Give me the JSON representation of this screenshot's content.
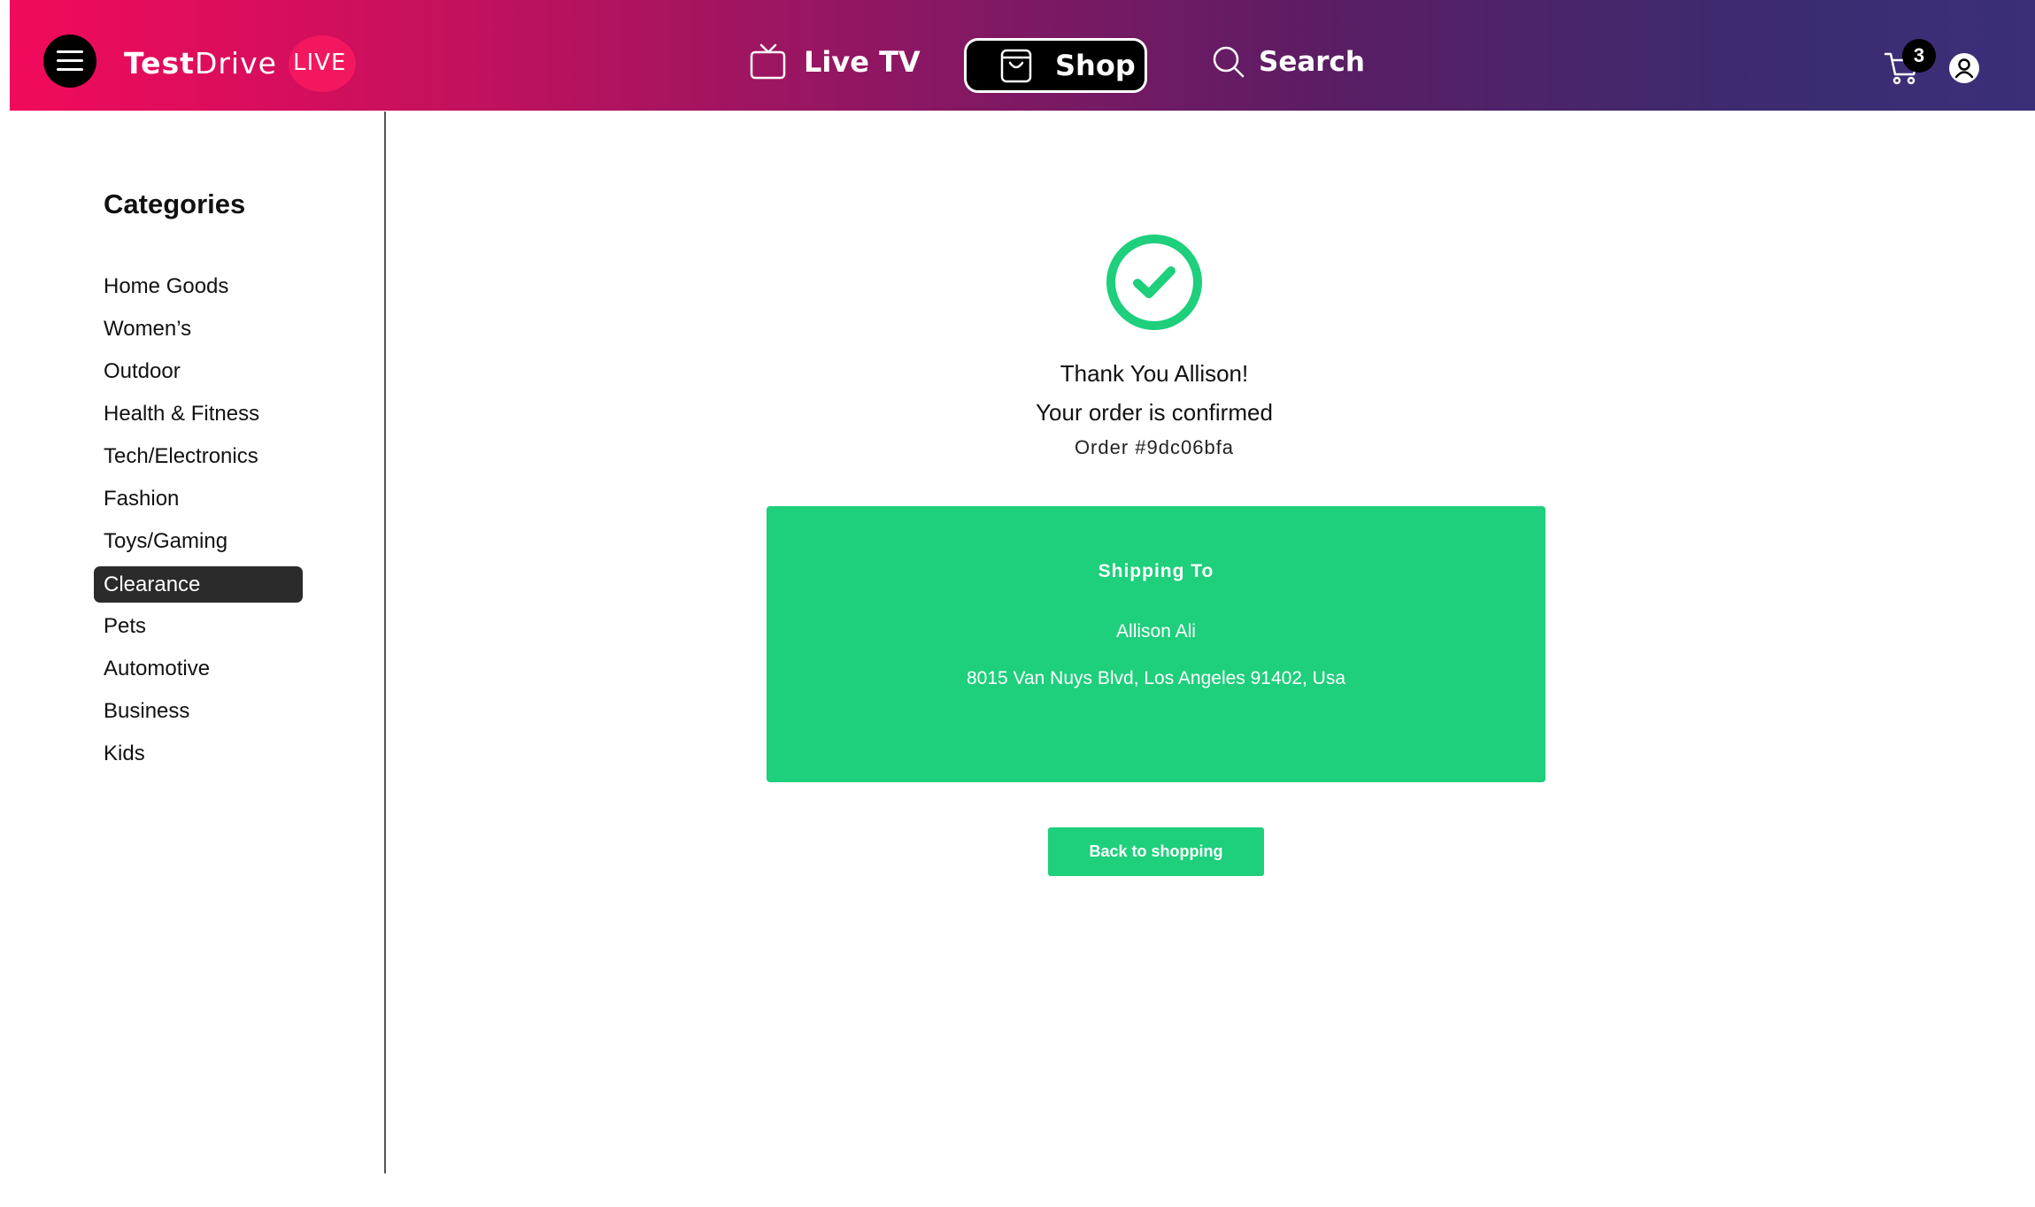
{
  "brand": {
    "name_bold": "Test",
    "name_regular": "Drive",
    "live_badge": "LIVE",
    "gradient_start": "#f20a5c",
    "gradient_end": "#3b2f7a"
  },
  "nav": {
    "menu_icon": "hamburger-menu-icon",
    "items": [
      {
        "label": "Live TV",
        "icon": "tv-icon"
      },
      {
        "label": "Shop",
        "icon": "shopping-bag-icon",
        "active": true
      },
      {
        "label": "Search",
        "icon": "search-icon"
      }
    ]
  },
  "header_actions": {
    "cart_icon": "cart-icon",
    "cart_count": "3",
    "user_icon": "user-icon"
  },
  "sidebar": {
    "title": "Categories",
    "items": [
      {
        "label": "Home Goods"
      },
      {
        "label": "Women’s"
      },
      {
        "label": "Outdoor"
      },
      {
        "label": "Health & Fitness"
      },
      {
        "label": "Tech/Electronics"
      },
      {
        "label": "Fashion"
      },
      {
        "label": "Toys/Gaming"
      },
      {
        "label": "Clearance",
        "active": true
      },
      {
        "label": "Pets"
      },
      {
        "label": "Automotive"
      },
      {
        "label": "Business"
      },
      {
        "label": "Kids"
      }
    ]
  },
  "confirmation": {
    "status_icon": "check-circle-icon",
    "thank_you": "Thank You Allison!",
    "confirmed": "Your order is confirmed",
    "order_number": "Order #9dc06bfa",
    "shipping": {
      "title": "Shipping To",
      "name": "Allison Ali",
      "address": "8015 Van Nuys Blvd, Los Angeles 91402, Usa"
    },
    "back_button": "Back to shopping",
    "accent_color": "#1ecf7c"
  }
}
